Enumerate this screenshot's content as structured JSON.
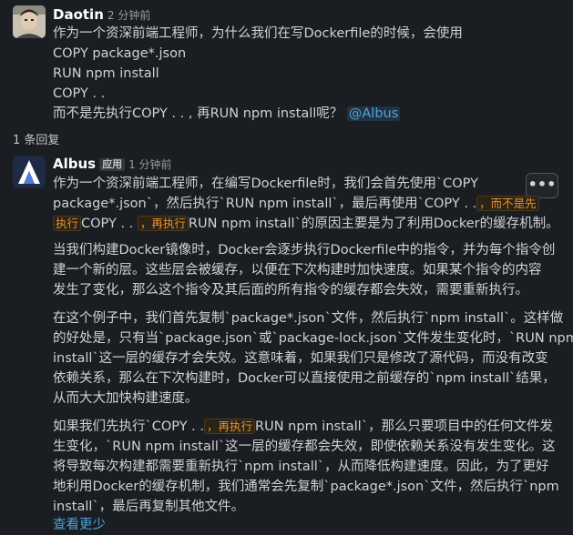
{
  "message1": {
    "author": "Daotin",
    "time": "2 分钟前",
    "lines": [
      "作为一个资深前端工程师，为什么我们在写Dockerfile的时候，会使用",
      "COPY package*.json",
      "RUN npm install",
      "COPY . .",
      "而不是先执行COPY . . , 再RUN npm install呢？"
    ],
    "mention": "@Albus"
  },
  "replies_label": "1 条回复",
  "message2": {
    "author": "Albus",
    "badge": "应用",
    "time": "1 分钟前",
    "p1_l1": "作为一个资深前端工程师，在编写Dockerfile时，我们会首先使用`COPY",
    "p1_l2": "package*.json`，然后执行`RUN npm install`，最后再使用`COPY . .",
    "p1_code1": "，而不是先",
    "p1_code1b": "执行",
    "p1_l3a": "COPY . .",
    "p1_code2": "，再执行",
    "p1_l3b": "RUN npm install`的原因主要是为了利用Docker的缓存机制。",
    "p2": [
      "当我们构建Docker镜像时，Docker会逐步执行Dockerfile中的指令，并为每个指令创",
      "建一个新的层。这些层会被缓存，以便在下次构建时加快速度。如果某个指令的内容",
      "发生了变化，那么这个指令及其后面的所有指令的缓存都会失效，需要重新执行。"
    ],
    "p3": [
      "在这个例子中，我们首先复制`package*.json`文件，然后执行`npm install`。这样做",
      "的好处是，只有当`package.json`或`package-lock.json`文件发生变化时，`RUN npm",
      "install`这一层的缓存才会失效。这意味着，如果我们只是修改了源代码，而没有改变",
      "依赖关系，那么在下次构建时，Docker可以直接使用之前缓存的`npm install`结果，",
      "从而大大加快构建速度。"
    ],
    "p4_l1a": "如果我们先执行`COPY . .",
    "p4_code": "，再执行",
    "p4_l1b": "RUN npm install`，那么只要项目中的任何文件发",
    "p4": [
      "生变化，`RUN npm install`这一层的缓存都会失效，即使依赖关系没有发生变化。这",
      "将导致每次构建都需要重新执行`npm install`，从而降低构建速度。因此，为了更好",
      "地利用Docker的缓存机制，我们通常会先复制`package*.json`文件，然后执行`npm",
      "install`，最后再复制其他文件。"
    ],
    "show_less": "查看更少",
    "more_button": "•••"
  }
}
